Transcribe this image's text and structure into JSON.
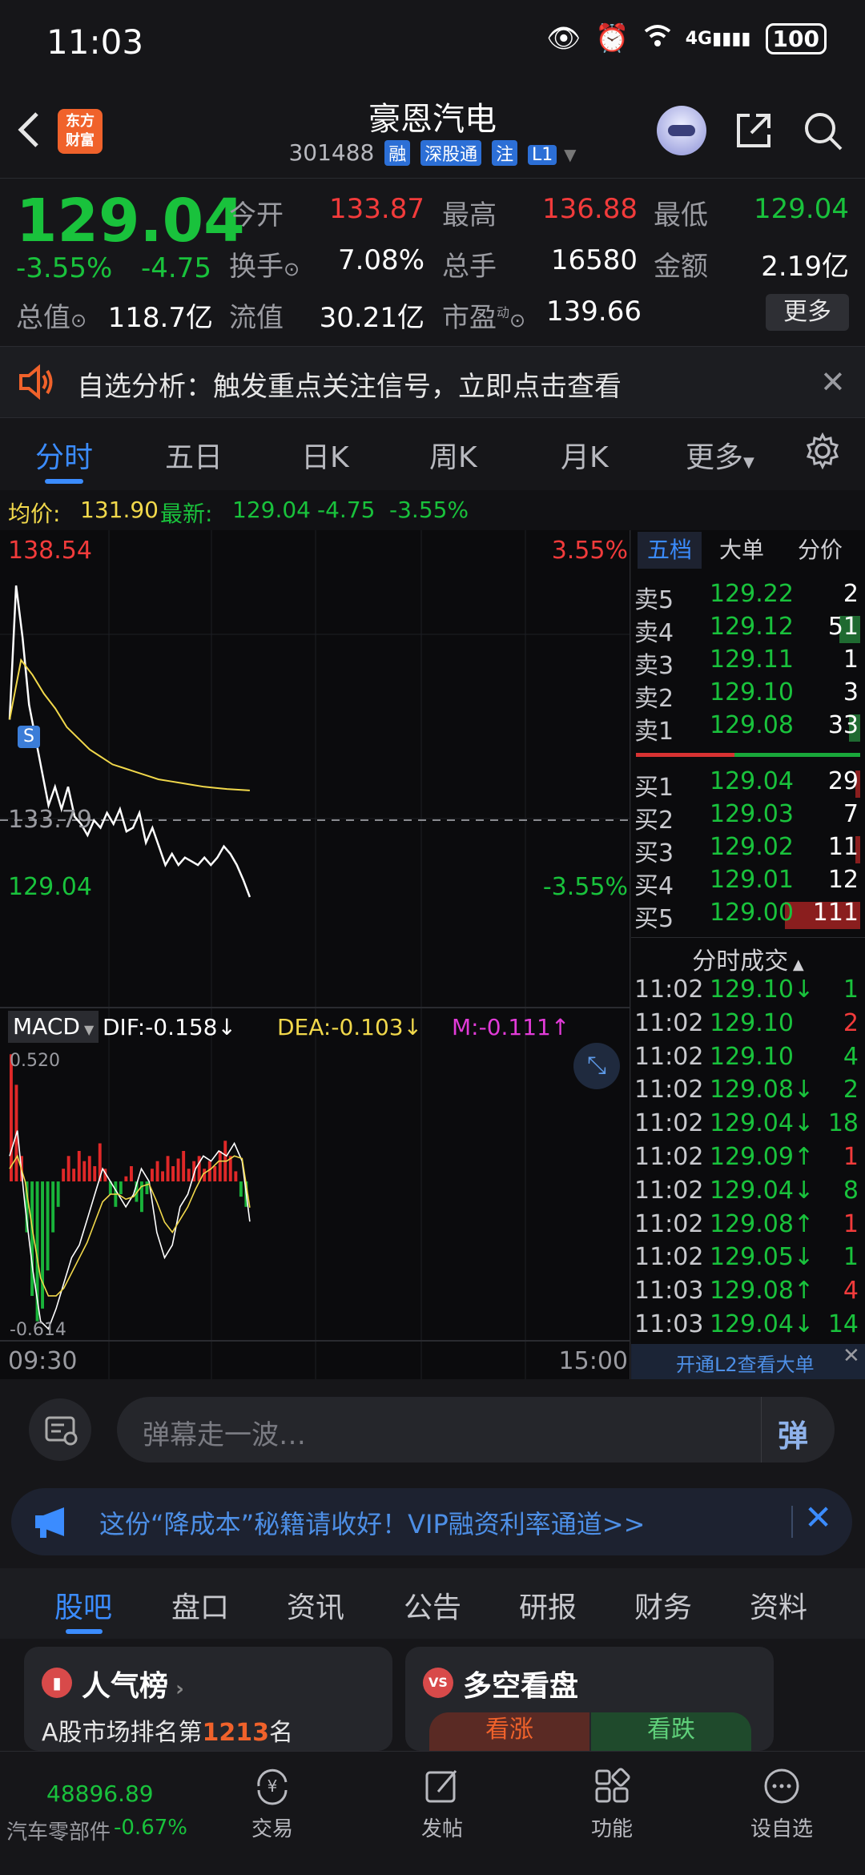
{
  "status_bar": {
    "time": "11:03",
    "battery": "100",
    "signal": "4G"
  },
  "header": {
    "logo_text": "东方财富",
    "stock_name": "豪恩汽电",
    "stock_code": "301488",
    "tags": [
      "融",
      "深股通",
      "注",
      "L1"
    ]
  },
  "quote": {
    "price": "129.04",
    "change_pct": "-3.55%",
    "change": "-4.75",
    "open_label": "今开",
    "open": "133.87",
    "high_label": "最高",
    "high": "136.88",
    "low_label": "最低",
    "low": "129.04",
    "turnover_label": "换手",
    "turnover": "7.08%",
    "volume_label": "总手",
    "volume": "16580",
    "amount_label": "金额",
    "amount": "2.19亿",
    "mktcap_label": "总值",
    "mktcap": "118.7亿",
    "float_label": "流值",
    "float": "30.21亿",
    "pe_label": "市盈",
    "pe_sup": "动",
    "pe": "139.66",
    "more_button": "更多"
  },
  "ticker": {
    "text": "自选分析：触发重点关注信号，立即点击查看"
  },
  "tabs": [
    "分时",
    "五日",
    "日K",
    "周K",
    "月K",
    "更多"
  ],
  "avg_line": {
    "avg_label": "均价:",
    "avg": "131.90",
    "latest_label": "最新:",
    "latest": "129.04",
    "change": "-4.75",
    "pct": "-3.55%"
  },
  "chart_labels": {
    "top_price": "138.54",
    "top_pct": "3.55%",
    "mid_price": "133.79",
    "bottom_price": "129.04",
    "bottom_pct": "-3.55%",
    "start_time": "09:30",
    "end_time": "15:00",
    "macd_label": "MACD",
    "dif": "DIF:-0.158↓",
    "dea": "DEA:-0.103↓",
    "m": "M:-0.111↑",
    "macd_top": "0.520",
    "macd_bottom": "-0.614",
    "s_marker": "S"
  },
  "chart_data": {
    "type": "line",
    "title": "",
    "xlabel": "",
    "ylabel": "",
    "ylim": [
      129.04,
      138.54
    ],
    "x_range": [
      "09:30",
      "15:00"
    ],
    "series": [
      {
        "name": "",
        "color": "#ffffff",
        "values": [
          133.8,
          137.4,
          136.0,
          134.2,
          133.3,
          132.4,
          131.5,
          132.0,
          131.4,
          132.0,
          131.2,
          131.0,
          130.7,
          131.1,
          130.9,
          131.3,
          131.0,
          131.4,
          130.8,
          130.9,
          131.3,
          130.5,
          130.9,
          130.4,
          129.9,
          130.2,
          129.9,
          130.1,
          130.0,
          129.9,
          130.1,
          129.9,
          130.1,
          130.4,
          130.2,
          129.9,
          129.5,
          129.04
        ]
      },
      {
        "name": "",
        "color": "#f1d84b",
        "values": [
          133.8,
          135.4,
          135.0,
          134.5,
          134.1,
          133.6,
          133.3,
          133.0,
          132.8,
          132.6,
          132.5,
          132.4,
          132.3,
          132.2,
          132.15,
          132.1,
          132.05,
          132.0,
          131.97,
          131.94,
          131.92,
          131.9
        ]
      }
    ],
    "macd": {
      "ylim": [
        -0.614,
        0.52
      ],
      "bars": [
        0.5,
        0.38,
        0.1,
        -0.2,
        -0.45,
        -0.55,
        -0.5,
        -0.35,
        -0.2,
        -0.1,
        0.05,
        0.1,
        0.05,
        0.12,
        0.08,
        0.1,
        0.06,
        0.15,
        0.05,
        -0.05,
        -0.1,
        -0.05,
        0.02,
        0.06,
        -0.08,
        -0.12,
        -0.05,
        0.05,
        0.08,
        0.04,
        0.1,
        0.06,
        0.09,
        0.12,
        0.05,
        0.08,
        0.1,
        0.05,
        0.08,
        0.06,
        0.12,
        0.16,
        0.1,
        0.04,
        -0.06,
        -0.1
      ],
      "dif": [
        0.1,
        0.2,
        -0.1,
        -0.35,
        -0.55,
        -0.58,
        -0.5,
        -0.4,
        -0.3,
        -0.25,
        -0.15,
        -0.05,
        0.05,
        0.0,
        -0.05,
        -0.1,
        -0.05,
        0.05,
        0.0,
        -0.2,
        -0.3,
        -0.25,
        -0.1,
        -0.05,
        0.05,
        0.1,
        0.08,
        0.12,
        0.1,
        0.15,
        0.08,
        -0.158
      ],
      "dea": [
        0.05,
        0.1,
        0.0,
        -0.2,
        -0.38,
        -0.45,
        -0.45,
        -0.42,
        -0.36,
        -0.3,
        -0.24,
        -0.16,
        -0.08,
        -0.05,
        -0.05,
        -0.07,
        -0.06,
        -0.02,
        -0.01,
        -0.08,
        -0.16,
        -0.2,
        -0.15,
        -0.1,
        -0.03,
        0.03,
        0.05,
        0.08,
        0.08,
        0.1,
        0.09,
        -0.103
      ]
    }
  },
  "orderbook": {
    "tabs": [
      "五档",
      "大单",
      "分价"
    ],
    "asks": [
      {
        "label": "卖5",
        "price": "129.22",
        "vol": "2"
      },
      {
        "label": "卖4",
        "price": "129.12",
        "vol": "51"
      },
      {
        "label": "卖3",
        "price": "129.11",
        "vol": "1"
      },
      {
        "label": "卖2",
        "price": "129.10",
        "vol": "3"
      },
      {
        "label": "卖1",
        "price": "129.08",
        "vol": "33"
      }
    ],
    "bids": [
      {
        "label": "买1",
        "price": "129.04",
        "vol": "29"
      },
      {
        "label": "买2",
        "price": "129.03",
        "vol": "7"
      },
      {
        "label": "买3",
        "price": "129.02",
        "vol": "11"
      },
      {
        "label": "买4",
        "price": "129.01",
        "vol": "12"
      },
      {
        "label": "买5",
        "price": "129.00",
        "vol": "111"
      }
    ],
    "trades_title": "分时成交",
    "trades": [
      {
        "time": "11:02",
        "price": "129.10↓",
        "vol": "1",
        "side": "sell"
      },
      {
        "time": "11:02",
        "price": "129.10",
        "vol": "2",
        "side": "buy"
      },
      {
        "time": "11:02",
        "price": "129.10",
        "vol": "4",
        "side": "sell"
      },
      {
        "time": "11:02",
        "price": "129.08↓",
        "vol": "2",
        "side": "sell"
      },
      {
        "time": "11:02",
        "price": "129.04↓",
        "vol": "18",
        "side": "sell"
      },
      {
        "time": "11:02",
        "price": "129.09↑",
        "vol": "1",
        "side": "buy"
      },
      {
        "time": "11:02",
        "price": "129.04↓",
        "vol": "8",
        "side": "sell"
      },
      {
        "time": "11:02",
        "price": "129.08↑",
        "vol": "1",
        "side": "buy"
      },
      {
        "time": "11:02",
        "price": "129.05↓",
        "vol": "1",
        "side": "sell"
      },
      {
        "time": "11:03",
        "price": "129.08↑",
        "vol": "4",
        "side": "buy"
      },
      {
        "time": "11:03",
        "price": "129.04↓",
        "vol": "14",
        "side": "sell"
      }
    ],
    "l2_link": "开通L2查看大单"
  },
  "danmu": {
    "placeholder": "弹幕走一波…",
    "button": "弹"
  },
  "promo": {
    "text": "这份“降成本”秘籍请收好！VIP融资利率通道>>"
  },
  "subtabs": [
    "股吧",
    "盘口",
    "资讯",
    "公告",
    "研报",
    "财务",
    "资料"
  ],
  "cards": {
    "popular_title": "人气榜",
    "popular_rank_prefix": "A股市场排名第",
    "popular_rank": "1213",
    "popular_rank_suffix": "名",
    "vs_title": "多空看盘",
    "bull": "看涨",
    "bear": "看跌"
  },
  "bottom_nav": {
    "index_value": "48896.89",
    "index_name": "汽车零部件",
    "index_pct": "-0.67%",
    "items": [
      "交易",
      "发帖",
      "功能",
      "设自选"
    ]
  },
  "colors": {
    "up": "#f23b3b",
    "down": "#19c23c",
    "accent": "#3b8cff",
    "avg": "#f1d84b"
  }
}
